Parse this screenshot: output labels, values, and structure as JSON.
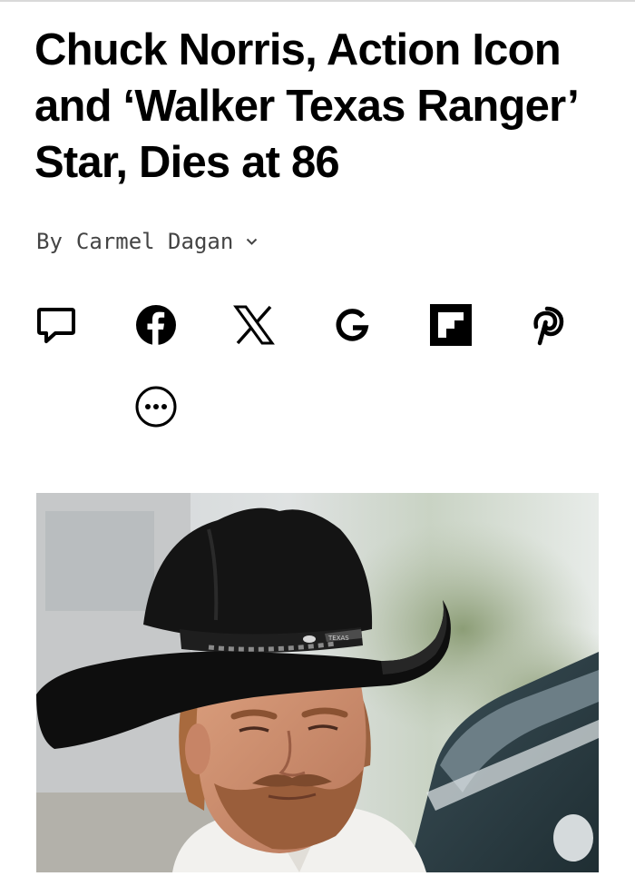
{
  "article": {
    "headline": "Chuck Norris, Action Icon and ‘Walker Texas Ranger’ Star, Dies at 86",
    "byline_prefix": "By",
    "author": "Carmel Dagan"
  },
  "share_bar": {
    "icons": [
      "comment-icon",
      "facebook-icon",
      "x-icon",
      "google-icon",
      "flipboard-icon",
      "pinterest-icon",
      "more-icon"
    ]
  },
  "hero_image": {
    "hat_band_text": "TEXAS"
  },
  "colors": {
    "text": "#000000",
    "byline": "#444444",
    "rule": "#d9d9d9"
  }
}
